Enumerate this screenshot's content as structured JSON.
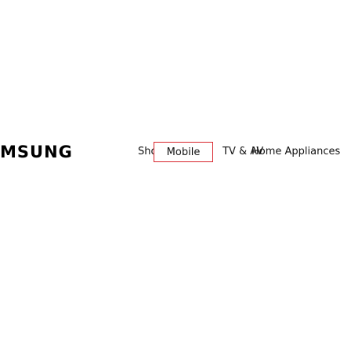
{
  "header": {
    "logo_text": "MSUNG",
    "nav": {
      "shop": "Shop",
      "mobile": "Mobile",
      "tv_av": "TV & AV",
      "home_appliances": "Home Appliances"
    },
    "active_item": "Mobile",
    "active_border_color": "#d8232a"
  }
}
